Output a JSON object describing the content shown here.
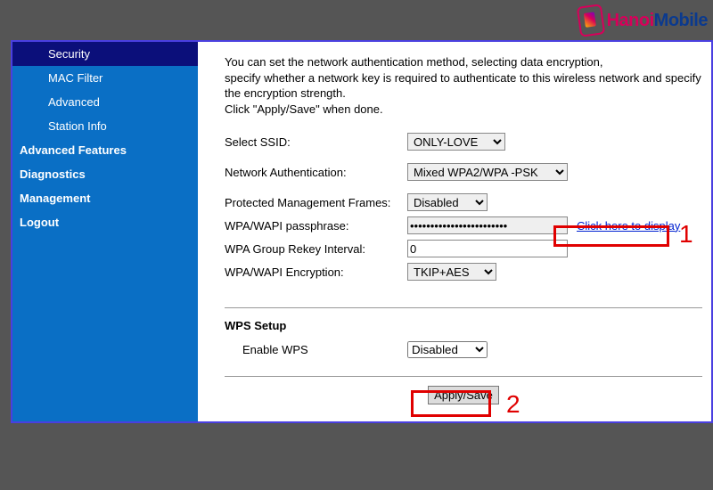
{
  "watermark": {
    "text_a": "Hanoi",
    "text_b": "Mobile"
  },
  "sidebar": {
    "items": [
      {
        "label": "Security",
        "level": 2,
        "active": true
      },
      {
        "label": "MAC Filter",
        "level": 2,
        "active": false
      },
      {
        "label": "Advanced",
        "level": 2,
        "active": false
      },
      {
        "label": "Station Info",
        "level": 2,
        "active": false
      },
      {
        "label": "Advanced Features",
        "level": 1,
        "active": false
      },
      {
        "label": "Diagnostics",
        "level": 1,
        "active": false
      },
      {
        "label": "Management",
        "level": 1,
        "active": false
      },
      {
        "label": "Logout",
        "level": 1,
        "active": false
      }
    ]
  },
  "desc": {
    "line1": "You can set the network authentication method, selecting data encryption,",
    "line2": "specify whether a network key is required to authenticate to this wireless network and specify the encryption strength.",
    "line3": "Click \"Apply/Save\" when done."
  },
  "form": {
    "ssid_label": "Select SSID:",
    "ssid_value": "ONLY-LOVE",
    "auth_label": "Network Authentication:",
    "auth_value": "Mixed WPA2/WPA -PSK",
    "pmf_label": "Protected Management Frames:",
    "pmf_value": "Disabled",
    "pass_label": "WPA/WAPI passphrase:",
    "pass_value": "••••••••••••••••••••••••",
    "pass_link": "Click here to display",
    "rekey_label": "WPA Group Rekey Interval:",
    "rekey_value": "0",
    "enc_label": "WPA/WAPI Encryption:",
    "enc_value": "TKIP+AES"
  },
  "wps": {
    "title": "WPS Setup",
    "enable_label": "Enable WPS",
    "enable_value": "Disabled"
  },
  "button": {
    "apply": "Apply/Save"
  },
  "annotations": {
    "one": "1",
    "two": "2"
  }
}
